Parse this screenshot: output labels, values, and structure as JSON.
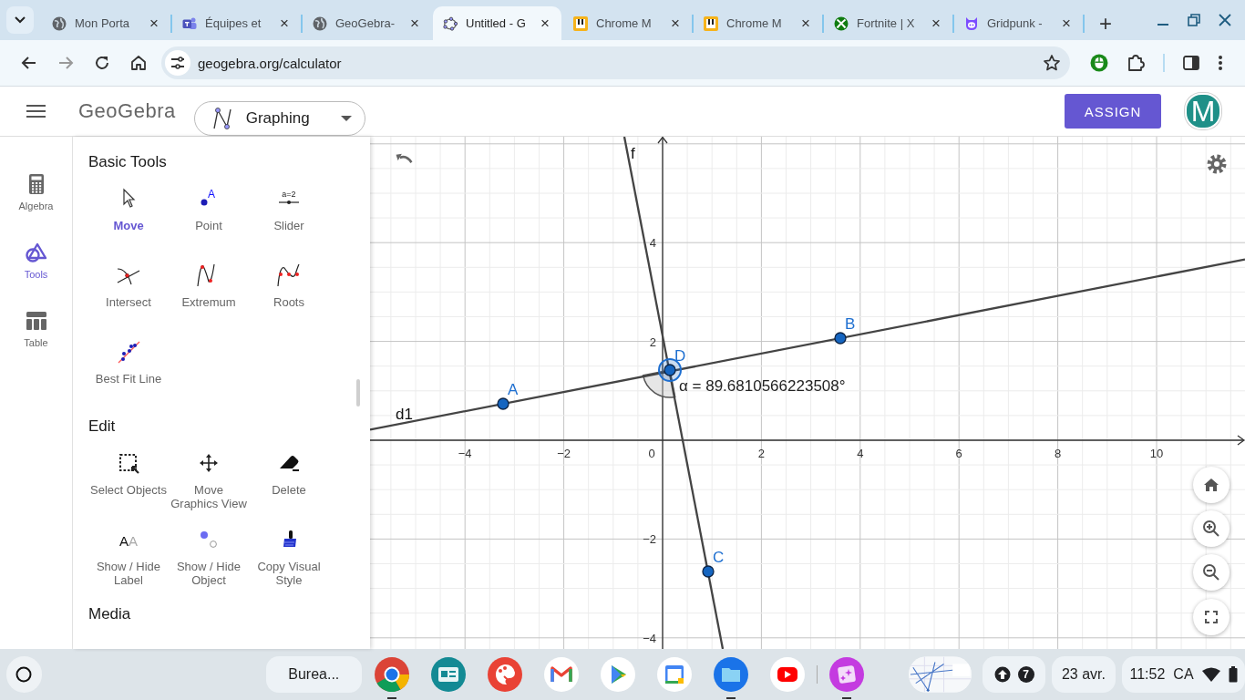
{
  "browser": {
    "tabs": [
      {
        "title": "Mon Porta",
        "close": "×",
        "selected": false
      },
      {
        "title": "Équipes et",
        "close": "×",
        "selected": false
      },
      {
        "title": "GeoGebra-",
        "close": "×",
        "selected": false
      },
      {
        "title": "Untitled - G",
        "close": "×",
        "selected": true
      },
      {
        "title": "Chrome M",
        "close": "×",
        "selected": false
      },
      {
        "title": "Chrome M",
        "close": "×",
        "selected": false
      },
      {
        "title": "Fortnite | X",
        "close": "×",
        "selected": false
      },
      {
        "title": "Gridpunk -",
        "close": "×",
        "selected": false
      }
    ],
    "new_tab": "+",
    "address": "geogebra.org/calculator"
  },
  "app": {
    "logo": "GeoGebra",
    "app_picker": "Graphing",
    "assign_button": "ASSIGN",
    "avatar": "M"
  },
  "rail": [
    {
      "label": "Algebra",
      "selected": false
    },
    {
      "label": "Tools",
      "selected": true
    },
    {
      "label": "Table",
      "selected": false
    }
  ],
  "tool_sections": [
    {
      "title": "Basic Tools",
      "tools": [
        {
          "label": "Move",
          "selected": true
        },
        {
          "label": "Point",
          "selected": false,
          "icon_text": "A"
        },
        {
          "label": "Slider",
          "selected": false,
          "icon_text": "a=2"
        },
        {
          "label": "Intersect",
          "selected": false
        },
        {
          "label": "Extremum",
          "selected": false
        },
        {
          "label": "Roots",
          "selected": false
        },
        {
          "label": "Best Fit Line",
          "selected": false
        }
      ]
    },
    {
      "title": "Edit",
      "tools": [
        {
          "label": "Select Objects",
          "selected": false
        },
        {
          "label": "Move\nGraphics View",
          "selected": false
        },
        {
          "label": "Delete",
          "selected": false
        },
        {
          "label": "Show / Hide\nLabel",
          "selected": false,
          "icon_text": "AA"
        },
        {
          "label": "Show / Hide\nObject",
          "selected": false
        },
        {
          "label": "Copy Visual\nStyle",
          "selected": false
        }
      ]
    },
    {
      "title": "Media"
    }
  ],
  "graph": {
    "x_ticks": [
      "−4",
      "−2",
      "0",
      "2",
      "4",
      "6",
      "8",
      "10"
    ],
    "y_ticks": [
      "4",
      "2",
      "−2",
      "−4"
    ],
    "lines": [
      {
        "label": "d1"
      },
      {
        "label": "f"
      }
    ],
    "points": [
      {
        "label": "A",
        "selected": false
      },
      {
        "label": "B",
        "selected": false
      },
      {
        "label": "C",
        "selected": false
      },
      {
        "label": "D",
        "selected": true
      }
    ],
    "angle": "α = 89.6810566223508°"
  },
  "taskbar": {
    "desk": "Burea...",
    "notifications": "7",
    "date": "23 avr.",
    "time": "11:52",
    "keyboard": "CA"
  }
}
